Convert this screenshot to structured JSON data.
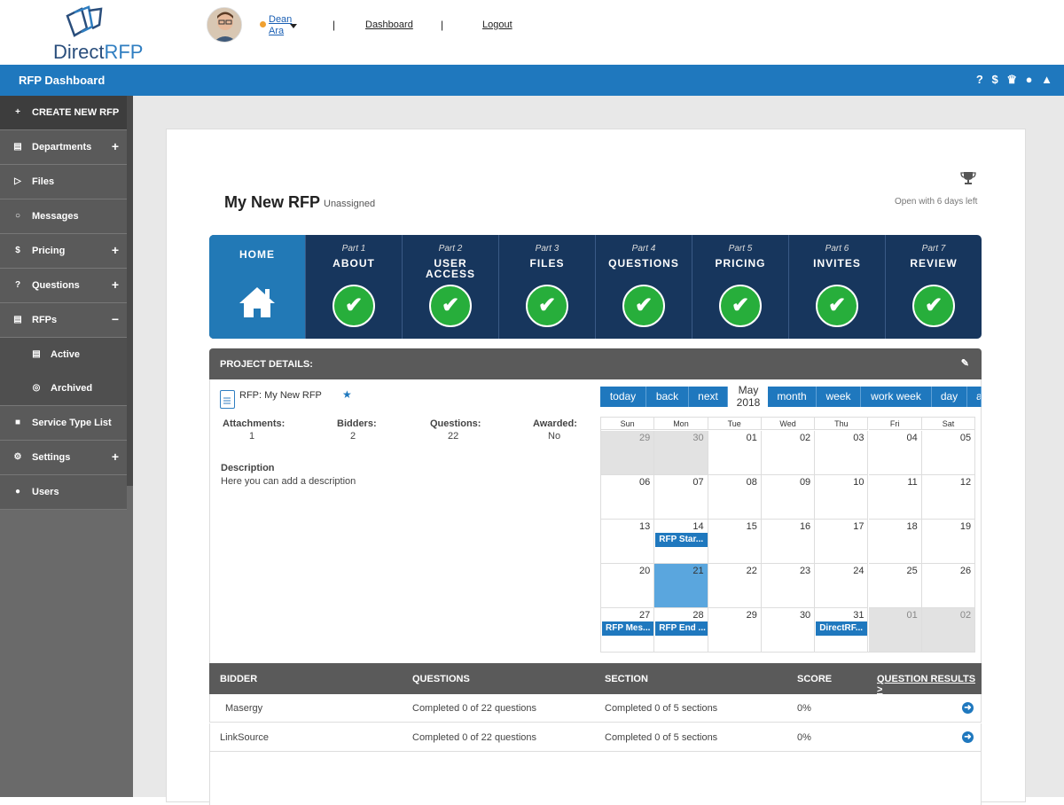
{
  "header": {
    "logo_main": "Direct",
    "logo_accent": "RFP",
    "user_first": "Dean",
    "user_last": "Ara",
    "sep1": "|",
    "sep2": "|",
    "dashboard_link": "Dashboard",
    "logout_link": "Logout"
  },
  "bluebar": {
    "title": "RFP Dashboard",
    "icons": [
      "question-icon",
      "dollar-icon",
      "trophy-icon",
      "chat-icon",
      "bell-icon"
    ],
    "icon_glyphs": "? $ ☘ ● ▲"
  },
  "sidebar": {
    "create": {
      "icon": "+",
      "label": "CREATE NEW RFP"
    },
    "items": [
      {
        "icon": "▤",
        "label": "Departments",
        "toggle": "+"
      },
      {
        "icon": "▷",
        "label": "Files"
      },
      {
        "icon": "○",
        "label": "Messages"
      },
      {
        "icon": "$",
        "label": "Pricing",
        "toggle": "+"
      },
      {
        "icon": "?",
        "label": "Questions",
        "toggle": "+"
      },
      {
        "icon": "▤",
        "label": "RFPs",
        "toggle": "−"
      },
      {
        "icon": "▤",
        "label": "Active"
      },
      {
        "icon": "◎",
        "label": "Archived"
      },
      {
        "icon": "■",
        "label": "Service Type List"
      },
      {
        "icon": "⚙",
        "label": "Settings",
        "toggle": "+"
      },
      {
        "icon": "●",
        "label": "Users"
      }
    ]
  },
  "rfp": {
    "title": "My New RFP",
    "status": "Unassigned",
    "open_text": "Open with 6 days left",
    "trophy_glyph": "🏆"
  },
  "steps": {
    "home": "HOME",
    "parts": [
      {
        "part": "Part 1",
        "name": "ABOUT"
      },
      {
        "part": "Part 2",
        "name": "USER ACCESS"
      },
      {
        "part": "Part 3",
        "name": "FILES"
      },
      {
        "part": "Part 4",
        "name": "QUESTIONS"
      },
      {
        "part": "Part 5",
        "name": "PRICING"
      },
      {
        "part": "Part 6",
        "name": "INVITES"
      },
      {
        "part": "Part 7",
        "name": "REVIEW"
      }
    ],
    "check": "✔"
  },
  "project": {
    "heading": "PROJECT DETAILS:",
    "edit_glyph": "✎",
    "rfp_label": "RFP: My New RFP",
    "star": "★",
    "stats": [
      {
        "label": "Attachments:",
        "value": "1"
      },
      {
        "label": "Bidders:",
        "value": "2"
      },
      {
        "label": "Questions:",
        "value": "22"
      },
      {
        "label": "Awarded:",
        "value": "No"
      }
    ],
    "desc_label": "Description",
    "desc_value": "Here you can add a description"
  },
  "calendar": {
    "nav": [
      "today",
      "back",
      "next"
    ],
    "month": "May",
    "year": "2018",
    "views": [
      "month",
      "week",
      "work week",
      "day",
      "a"
    ],
    "dow": [
      "Sun",
      "Mon",
      "Tue",
      "Wed",
      "Thu",
      "Fri",
      "Sat"
    ],
    "weeks": [
      [
        "29",
        "30",
        "01",
        "02",
        "03",
        "04",
        "05"
      ],
      [
        "06",
        "07",
        "08",
        "09",
        "10",
        "11",
        "12"
      ],
      [
        "13",
        "14",
        "15",
        "16",
        "17",
        "18",
        "19"
      ],
      [
        "20",
        "21",
        "22",
        "23",
        "24",
        "25",
        "26"
      ],
      [
        "27",
        "28",
        "29",
        "30",
        "31",
        "01",
        "02"
      ]
    ],
    "events": [
      {
        "label": "RFP Star...",
        "week": 2,
        "day": 1
      },
      {
        "label": "RFP Mes...",
        "week": 4,
        "day": 0
      },
      {
        "label": "RFP End ...",
        "week": 4,
        "day": 1
      },
      {
        "label": "DirectRF...",
        "week": 4,
        "day": 4
      }
    ]
  },
  "bidders": {
    "headers": [
      "BIDDER",
      "QUESTIONS",
      "SECTION",
      "SCORE",
      "QUESTION RESULTS >"
    ],
    "rows": [
      {
        "bidder": "Masergy",
        "questions": "Completed 0 of 22 questions",
        "section": "Completed 0 of 5 sections",
        "score": "0%"
      },
      {
        "bidder": "LinkSource",
        "questions": "Completed 0 of 22 questions",
        "section": "Completed 0 of 5 sections",
        "score": "0%"
      }
    ],
    "arrow": "➜"
  }
}
